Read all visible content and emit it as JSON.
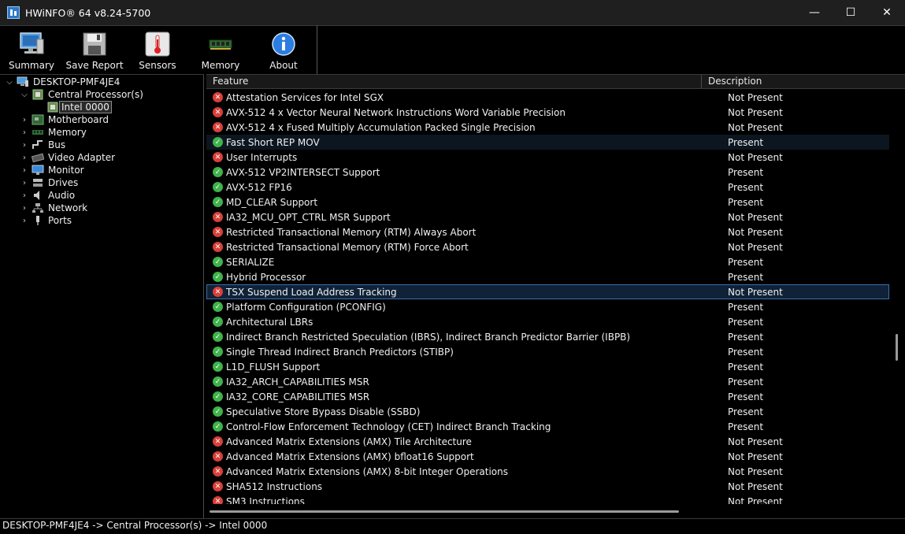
{
  "window": {
    "title": "HWiNFO® 64 v8.24-5700",
    "minimize": "—",
    "maximize": "☐",
    "close": "✕"
  },
  "toolbar": {
    "summary": "Summary",
    "save_report": "Save Report",
    "sensors": "Sensors",
    "memory": "Memory",
    "about": "About"
  },
  "tree": {
    "root": "DESKTOP-PMF4JE4",
    "cpu": "Central Processor(s)",
    "cpu_child": "Intel 0000",
    "motherboard": "Motherboard",
    "memory": "Memory",
    "bus": "Bus",
    "video": "Video Adapter",
    "monitor": "Monitor",
    "drives": "Drives",
    "audio": "Audio",
    "network": "Network",
    "ports": "Ports"
  },
  "list": {
    "col_feature": "Feature",
    "col_description": "Description",
    "rows": [
      {
        "feature": "Attestation Services for Intel SGX",
        "description": "Not Present"
      },
      {
        "feature": "AVX-512 4 x Vector Neural Network Instructions Word Variable Precision",
        "description": "Not Present"
      },
      {
        "feature": "AVX-512 4 x Fused Multiply Accumulation Packed Single Precision",
        "description": "Not Present"
      },
      {
        "feature": "Fast Short REP MOV",
        "description": "Present"
      },
      {
        "feature": "User Interrupts",
        "description": "Not Present"
      },
      {
        "feature": "AVX-512 VP2INTERSECT Support",
        "description": "Present"
      },
      {
        "feature": "AVX-512 FP16",
        "description": "Present"
      },
      {
        "feature": "MD_CLEAR Support",
        "description": "Present"
      },
      {
        "feature": "IA32_MCU_OPT_CTRL MSR Support",
        "description": "Not Present"
      },
      {
        "feature": "Restricted Transactional Memory (RTM) Always Abort",
        "description": "Not Present"
      },
      {
        "feature": "Restricted Transactional Memory (RTM) Force Abort",
        "description": "Not Present"
      },
      {
        "feature": "SERIALIZE",
        "description": "Present"
      },
      {
        "feature": "Hybrid Processor",
        "description": "Present"
      },
      {
        "feature": "TSX Suspend Load Address Tracking",
        "description": "Not Present"
      },
      {
        "feature": "Platform Configuration (PCONFIG)",
        "description": "Present"
      },
      {
        "feature": "Architectural LBRs",
        "description": "Present"
      },
      {
        "feature": "Indirect Branch Restricted Speculation (IBRS), Indirect Branch Predictor Barrier (IBPB)",
        "description": "Present"
      },
      {
        "feature": "Single Thread Indirect Branch Predictors (STIBP)",
        "description": "Present"
      },
      {
        "feature": "L1D_FLUSH Support",
        "description": "Present"
      },
      {
        "feature": "IA32_ARCH_CAPABILITIES MSR",
        "description": "Present"
      },
      {
        "feature": "IA32_CORE_CAPABILITIES MSR",
        "description": "Present"
      },
      {
        "feature": "Speculative Store Bypass Disable (SSBD)",
        "description": "Present"
      },
      {
        "feature": "Control-Flow Enforcement Technology (CET) Indirect Branch Tracking",
        "description": "Present"
      },
      {
        "feature": "Advanced Matrix Extensions (AMX) Tile Architecture",
        "description": "Not Present"
      },
      {
        "feature": "Advanced Matrix Extensions (AMX) bfloat16 Support",
        "description": "Not Present"
      },
      {
        "feature": "Advanced Matrix Extensions (AMX) 8-bit Integer Operations",
        "description": "Not Present"
      },
      {
        "feature": "SHA512 Instructions",
        "description": "Not Present"
      },
      {
        "feature": "SM3 Instructions",
        "description": "Not Present"
      }
    ]
  },
  "statusbar": {
    "path": "DESKTOP-PMF4JE4 -> Central Processor(s) -> Intel 0000"
  },
  "colors": {
    "present": "#3fb24a",
    "not_present": "#d8403a",
    "selection": "#3c6ea8"
  }
}
